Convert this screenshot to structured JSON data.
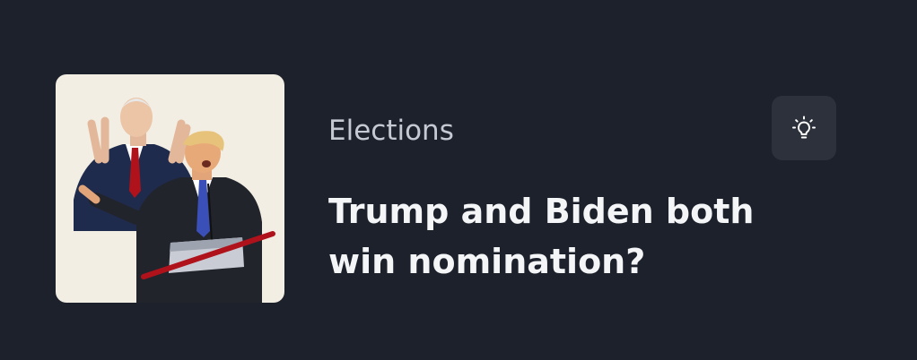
{
  "market": {
    "category": "Elections",
    "title": "Trump and Biden both win nomination?",
    "image": "biden-trump-illustration"
  },
  "actions": {
    "idea_icon": "lightbulb-icon"
  },
  "colors": {
    "background": "#1d212c",
    "thumbnail_background": "#f2eee3",
    "button_background": "#2c313c",
    "title_text": "#f4f5f7",
    "category_text": "#c4c9d2",
    "accent_red": "#b0121c"
  }
}
